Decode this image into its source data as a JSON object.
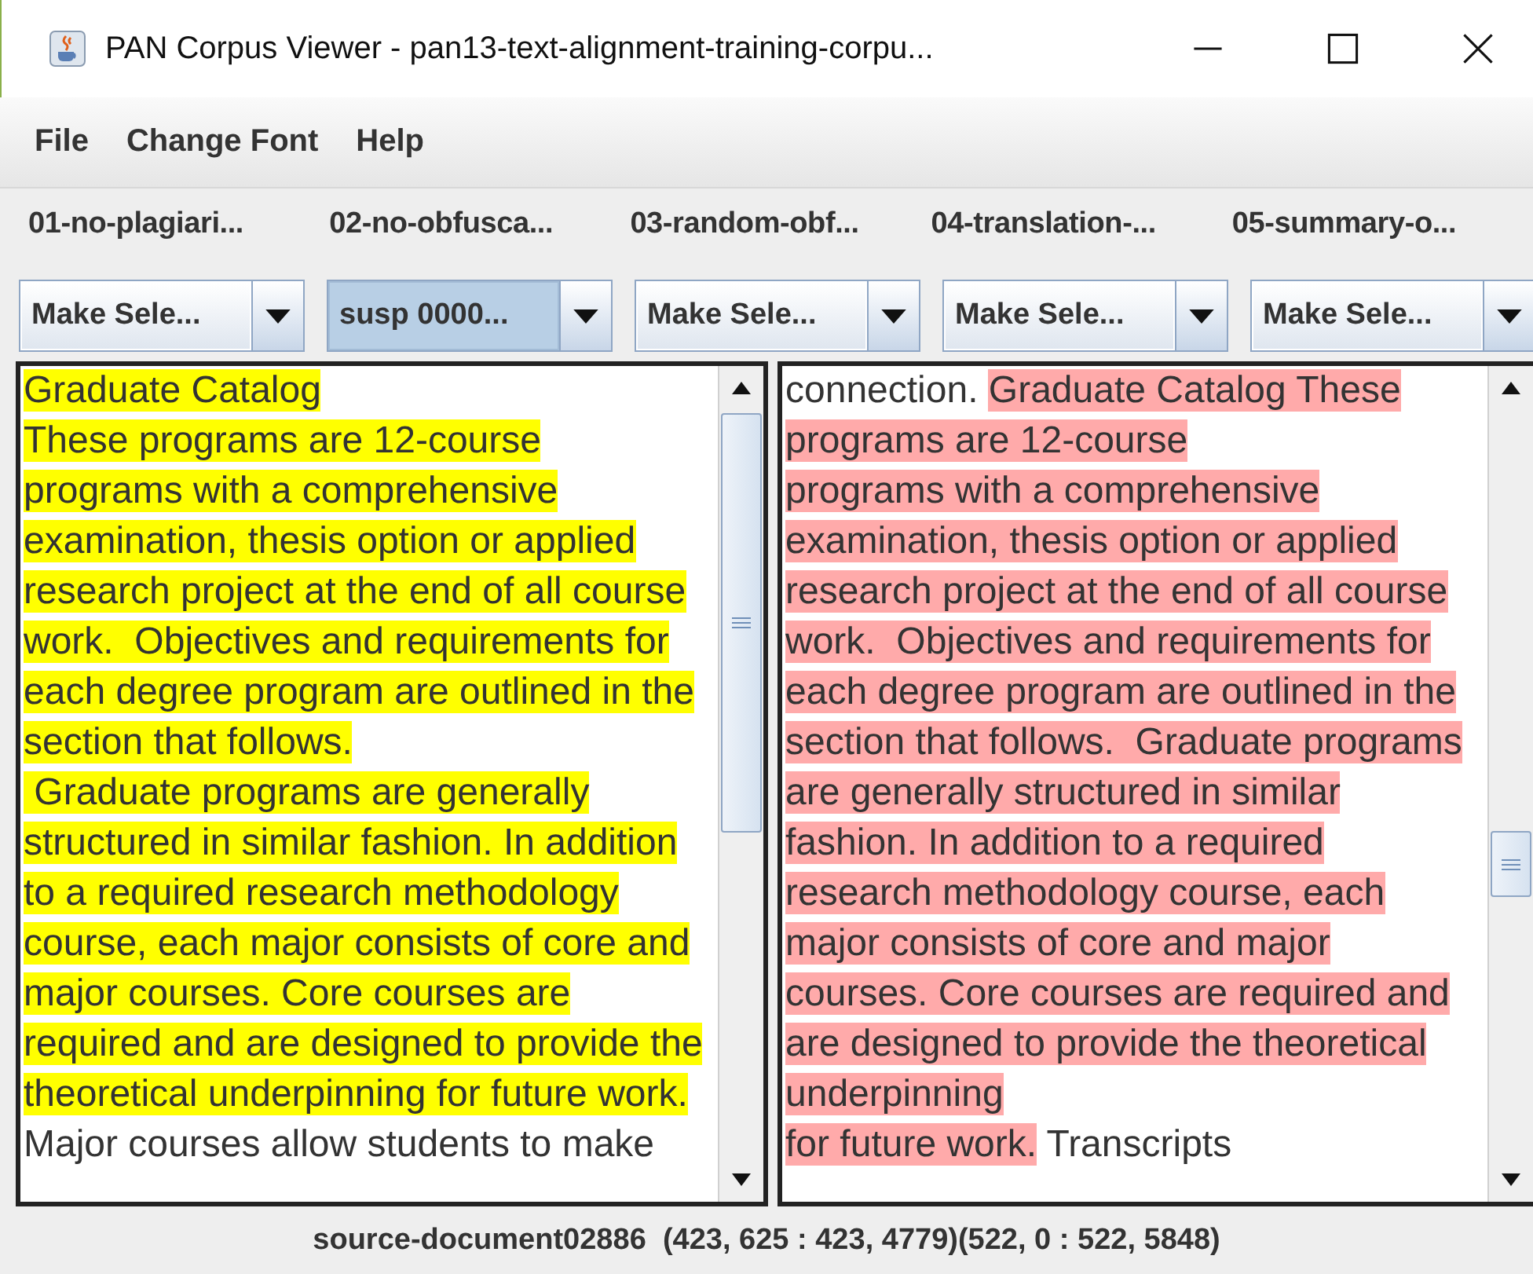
{
  "window": {
    "title": "PAN Corpus Viewer - pan13-text-alignment-training-corpu..."
  },
  "menu": [
    "File",
    "Change Font",
    "Help"
  ],
  "categories": [
    {
      "label": "01-no-plagiari...",
      "combo": "Make Sele...",
      "selected": false
    },
    {
      "label": "02-no-obfusca...",
      "combo": "susp 0000...",
      "selected": true
    },
    {
      "label": "03-random-obf...",
      "combo": "Make Sele...",
      "selected": false
    },
    {
      "label": "04-translation-...",
      "combo": "Make Sele...",
      "selected": false
    },
    {
      "label": "05-summary-o...",
      "combo": "Make Sele...",
      "selected": false
    }
  ],
  "panels": [
    {
      "kind": "suspicious",
      "lines": [
        [
          {
            "text": "Graduate Catalog",
            "highlighted": true
          }
        ],
        [
          {
            "text": "These programs are 12-course",
            "highlighted": true
          }
        ],
        [
          {
            "text": "programs with a comprehensive",
            "highlighted": true
          }
        ],
        [
          {
            "text": "examination, thesis option or applied",
            "highlighted": true
          }
        ],
        [
          {
            "text": "research project at the end of all course",
            "highlighted": true
          }
        ],
        [
          {
            "text": "work.  Objectives and requirements for",
            "highlighted": true
          }
        ],
        [
          {
            "text": "each degree program are outlined in the",
            "highlighted": true
          }
        ],
        [
          {
            "text": "section that follows.",
            "highlighted": true
          }
        ],
        [
          {
            "text": " Graduate programs are generally",
            "highlighted": true
          }
        ],
        [
          {
            "text": "structured in similar fashion. In addition",
            "highlighted": true
          }
        ],
        [
          {
            "text": "to a required research methodology",
            "highlighted": true
          }
        ],
        [
          {
            "text": "course, each major consists of core and",
            "highlighted": true
          }
        ],
        [
          {
            "text": "major courses. Core courses are",
            "highlighted": true
          }
        ],
        [
          {
            "text": "required and are designed to provide the",
            "highlighted": true
          }
        ],
        [
          {
            "text": "theoretical underpinning for future work.",
            "highlighted": true
          }
        ],
        [
          {
            "text": "Major courses allow students to make",
            "highlighted": false
          }
        ]
      ]
    },
    {
      "kind": "source",
      "lines": [
        [
          {
            "text": "connection. ",
            "highlighted": false
          },
          {
            "text": "Graduate Catalog These",
            "highlighted": true
          }
        ],
        [
          {
            "text": "programs are 12-course",
            "highlighted": true
          }
        ],
        [
          {
            "text": "programs with a comprehensive",
            "highlighted": true
          }
        ],
        [
          {
            "text": "examination, thesis option or applied",
            "highlighted": true
          }
        ],
        [
          {
            "text": "research project at the end of all course",
            "highlighted": true
          }
        ],
        [
          {
            "text": "work.  Objectives and requirements for",
            "highlighted": true
          }
        ],
        [
          {
            "text": "each degree program are outlined in the",
            "highlighted": true
          }
        ],
        [
          {
            "text": "section that follows.  Graduate programs",
            "highlighted": true
          }
        ],
        [
          {
            "text": "are generally structured in similar",
            "highlighted": true
          }
        ],
        [
          {
            "text": "fashion. In addition to a required",
            "highlighted": true
          }
        ],
        [
          {
            "text": "research methodology course, each",
            "highlighted": true
          }
        ],
        [
          {
            "text": "major consists of core and major",
            "highlighted": true
          }
        ],
        [
          {
            "text": "courses. Core courses are required and",
            "highlighted": true
          }
        ],
        [
          {
            "text": "are designed to provide the theoretical",
            "highlighted": true
          }
        ],
        [
          {
            "text": "underpinning",
            "highlighted": true
          }
        ],
        [
          {
            "text": "for future work.",
            "highlighted": true
          },
          {
            "text": " Transcripts",
            "highlighted": false
          }
        ]
      ]
    }
  ],
  "status_bar": "source-document02886  (423, 625 : 423, 4779)(522, 0 : 522, 5848)"
}
